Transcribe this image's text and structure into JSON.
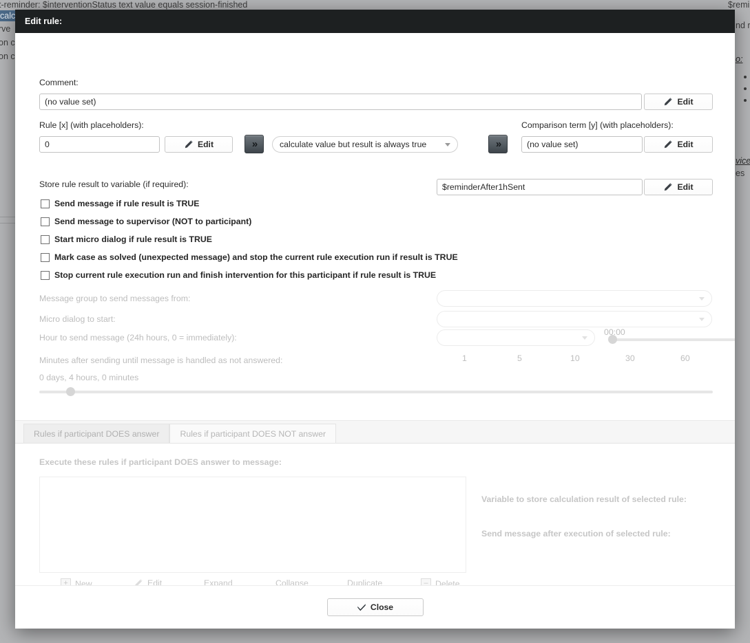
{
  "backdrop": {
    "top_text": "t-reminder: $interventionStatus text value equals session-finished",
    "top_right_text": "$remin",
    "left_lines": [
      {
        "text": "calc",
        "selected": true
      },
      {
        "text": "rve",
        "selected": false
      },
      {
        "text": "on c",
        "selected": false
      },
      {
        "text": "on c",
        "selected": false
      }
    ],
    "right_lines": [
      {
        "text": "nd r"
      },
      {
        "text": "o:"
      },
      {
        "text": "vice"
      },
      {
        "text": "es "
      }
    ]
  },
  "dialog": {
    "title": "Edit rule:",
    "comment": {
      "label": "Comment:",
      "value": "(no value set)",
      "edit_label": "Edit"
    },
    "rule": {
      "label": "Rule [x] (with placeholders):",
      "value": "0",
      "edit_label": "Edit"
    },
    "operator": {
      "value": "calculate value but result is always true"
    },
    "comparison": {
      "label": "Comparison term [y] (with placeholders):",
      "value": "(no value set)",
      "edit_label": "Edit"
    },
    "store_variable": {
      "label": "Store rule result to variable (if required):",
      "value": "$reminderAfter1hSent",
      "edit_label": "Edit"
    },
    "checkboxes": [
      {
        "label": "Send message if rule result is TRUE",
        "checked": false
      },
      {
        "label": "Send message to supervisor (NOT to participant)",
        "checked": false
      },
      {
        "label": "Start micro dialog if rule result is TRUE",
        "checked": false
      },
      {
        "label": "Mark case as solved (unexpected message) and stop the current rule execution run if result is TRUE",
        "checked": false
      },
      {
        "label": "Stop current rule execution run and finish intervention for this participant if rule result is TRUE",
        "checked": false
      }
    ],
    "message_group": {
      "label": "Message group to send messages from:",
      "value": ""
    },
    "micro_dialog": {
      "label": "Micro dialog to start:",
      "value": ""
    },
    "hour_to_send": {
      "label": "Hour to send message (24h hours, 0 = immediately):",
      "value": "",
      "time_display": "00:00"
    },
    "minutes_not_answered": {
      "label": "Minutes after sending until message is handled as not answered:",
      "ticks": [
        "1",
        "5",
        "10",
        "30",
        "60"
      ]
    },
    "duration": {
      "value": "0 days, 4 hours, 0 minutes"
    },
    "tabs": [
      {
        "label": "Rules if participant DOES answer",
        "active": true
      },
      {
        "label": "Rules if participant DOES NOT answer",
        "active": false
      }
    ],
    "subsection": {
      "heading": "Execute these rules if participant DOES answer to message:",
      "variable_label": "Variable to store calculation result of selected rule:",
      "send_message_label": "Send message after execution of selected rule:"
    },
    "list_toolbar": [
      {
        "label": "New",
        "icon": "plus-icon"
      },
      {
        "label": "Edit",
        "icon": "pencil-icon"
      },
      {
        "label": "Expand",
        "icon": "none"
      },
      {
        "label": "Collapse",
        "icon": "none"
      },
      {
        "label": "Duplicate",
        "icon": "none"
      },
      {
        "label": "Delete",
        "icon": "minus-icon"
      }
    ],
    "close": {
      "label": "Close"
    }
  },
  "colors": {
    "titlebar": "#1d2021",
    "backdrop": "#a9aaac",
    "selection": "#4c6b8a",
    "dim_text": "#bdbdbd"
  }
}
